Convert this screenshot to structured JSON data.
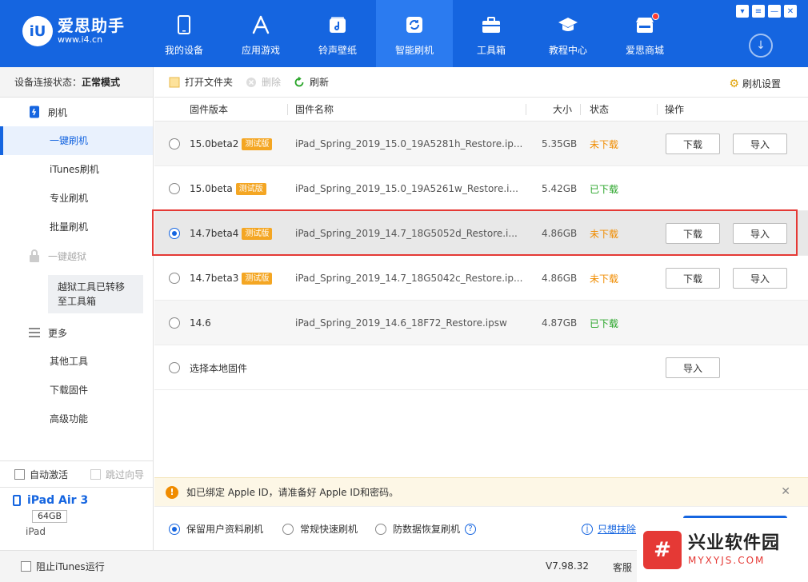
{
  "app": {
    "logo_mark": "iU",
    "name": "爱思助手",
    "url": "www.i4.cn"
  },
  "nav": [
    {
      "label": "我的设备",
      "icon": "phone-icon"
    },
    {
      "label": "应用游戏",
      "icon": "appstore-icon"
    },
    {
      "label": "铃声壁纸",
      "icon": "music-icon"
    },
    {
      "label": "智能刷机",
      "icon": "refresh-icon",
      "active": true
    },
    {
      "label": "工具箱",
      "icon": "toolbox-icon"
    },
    {
      "label": "教程中心",
      "icon": "graduation-cap-icon"
    },
    {
      "label": "爱思商城",
      "icon": "shop-icon",
      "notification_dot": true
    }
  ],
  "sidebar": {
    "status_label": "设备连接状态：",
    "status_value": "正常模式",
    "group_flash": "刷机",
    "items_flash": [
      "一键刷机",
      "iTunes刷机",
      "专业刷机",
      "批量刷机"
    ],
    "group_jailbreak": "一键越狱",
    "jailbreak_note": "越狱工具已转移至工具箱",
    "group_more": "更多",
    "items_more": [
      "其他工具",
      "下载固件",
      "高级功能"
    ],
    "auto_activate": "自动激活",
    "skip_guide": "跳过向导",
    "device_name": "iPad Air 3",
    "device_capacity": "64GB",
    "device_type": "iPad"
  },
  "toolbar": {
    "open_folder": "打开文件夹",
    "delete": "删除",
    "refresh": "刷新",
    "settings": "刷机设置"
  },
  "table": {
    "headers": {
      "version": "固件版本",
      "name": "固件名称",
      "size": "大小",
      "status": "状态",
      "action": "操作"
    },
    "rows": [
      {
        "version": "15.0beta2",
        "badge": "测试版",
        "name": "iPad_Spring_2019_15.0_19A5281h_Restore.ip...",
        "size": "5.35GB",
        "status": "未下载",
        "downloaded": false
      },
      {
        "version": "15.0beta",
        "badge": "测试版",
        "name": "iPad_Spring_2019_15.0_19A5261w_Restore.i...",
        "size": "5.42GB",
        "status": "已下载",
        "downloaded": true
      },
      {
        "version": "14.7beta4",
        "badge": "测试版",
        "name": "iPad_Spring_2019_14.7_18G5052d_Restore.i...",
        "size": "4.86GB",
        "status": "未下载",
        "downloaded": false,
        "selected": true
      },
      {
        "version": "14.7beta3",
        "badge": "测试版",
        "name": "iPad_Spring_2019_14.7_18G5042c_Restore.ip...",
        "size": "4.86GB",
        "status": "未下载",
        "downloaded": false
      },
      {
        "version": "14.6",
        "badge": "",
        "name": "iPad_Spring_2019_14.6_18F72_Restore.ipsw",
        "size": "4.87GB",
        "status": "已下载",
        "downloaded": true
      },
      {
        "version": "选择本地固件",
        "badge": "",
        "name": "",
        "size": "",
        "status": "",
        "local": true
      }
    ],
    "download_label": "下载",
    "import_label": "导入"
  },
  "notice": {
    "text": "如已绑定 Apple ID，请准备好 Apple ID和密码。"
  },
  "options": {
    "keep_data": "保留用户资料刷机",
    "quick_flash": "常规快速刷机",
    "anti_recovery": "防数据恢复刷机",
    "erase_only": "只想抹除"
  },
  "footer": {
    "block_itunes": "阻止iTunes运行",
    "version": "V7.98.32",
    "service": "客服"
  },
  "watermark": {
    "mark": "#",
    "name": "兴业软件园",
    "url": "MYXYJS.COM"
  },
  "colors": {
    "brand": "#1565e0",
    "not_downloaded": "#f08c00",
    "downloaded": "#2aa52a",
    "badge": "#f4a623",
    "selection_frame": "#e53935"
  }
}
